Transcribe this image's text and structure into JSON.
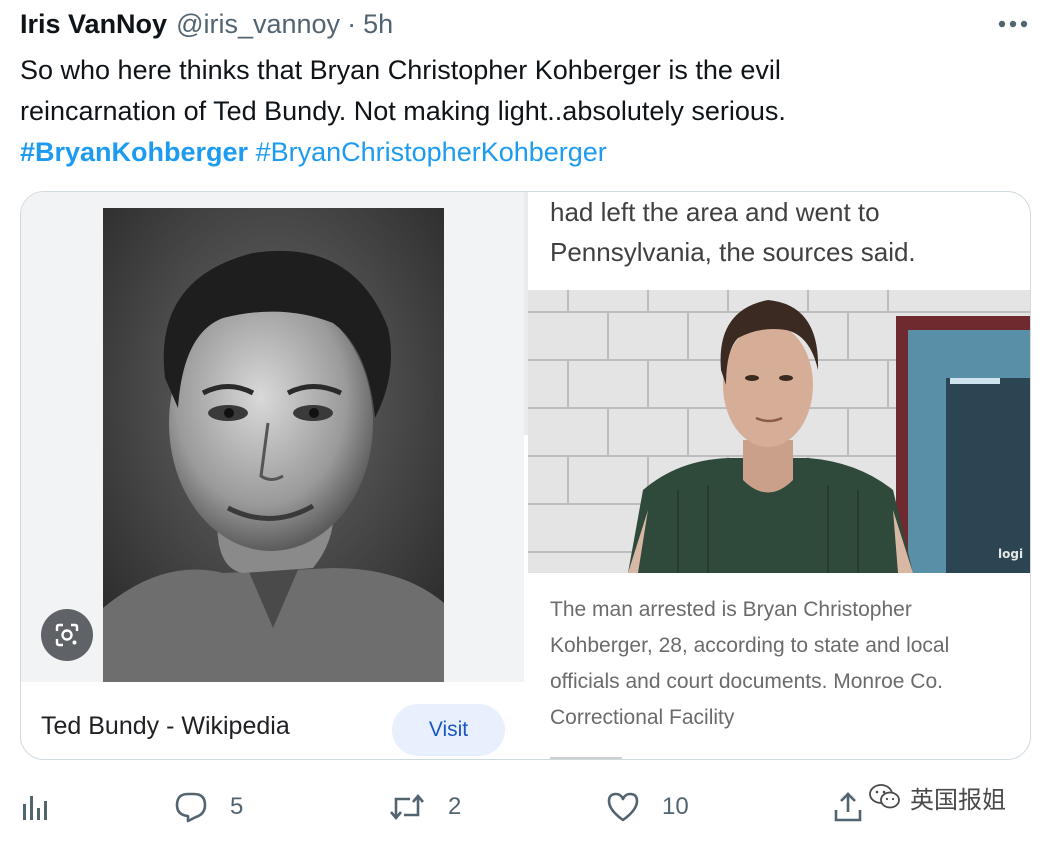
{
  "tweet": {
    "author_name": "Iris VanNoy",
    "handle": "@iris_vannoy",
    "separator": "·",
    "time": "5h",
    "text_line1": "So who here thinks that Bryan Christopher Kohberger is the evil",
    "text_line2": "reincarnation of Ted Bundy. Not making light..absolutely serious.",
    "hashtag1": "#BryanKohberger",
    "hashtag2": "#BryanChristopherKohberger"
  },
  "media": {
    "left_caption": "Ted Bundy - Wikipedia",
    "visit_label": "Visit",
    "article_top_line1": "had left the area and went to",
    "article_top_line2": "Pennsylvania, the sources said.",
    "mugshot_watermark": "logi",
    "article_caption_line1": "The man arrested is Bryan Christopher",
    "article_caption_line2": "Kohberger, 28, according to state and local",
    "article_caption_line3": "officials and court documents. Monroe Co.",
    "article_caption_line4": "Correctional Facility"
  },
  "actions": {
    "reply_count": "5",
    "retweet_count": "2",
    "like_count": "10"
  },
  "watermark": {
    "text": "英国报姐"
  },
  "colors": {
    "hashtag": "#1d9bf0",
    "secondary_text": "#536471",
    "visit_bg": "#e8f0fe",
    "visit_text": "#1a56c4"
  },
  "icons": {
    "more": "more-horizontal-icon",
    "lens": "google-lens-icon",
    "analytics": "analytics-icon",
    "reply": "reply-icon",
    "retweet": "retweet-icon",
    "like": "heart-icon",
    "share": "share-icon",
    "watermark_logo": "wechat-logo-icon"
  }
}
